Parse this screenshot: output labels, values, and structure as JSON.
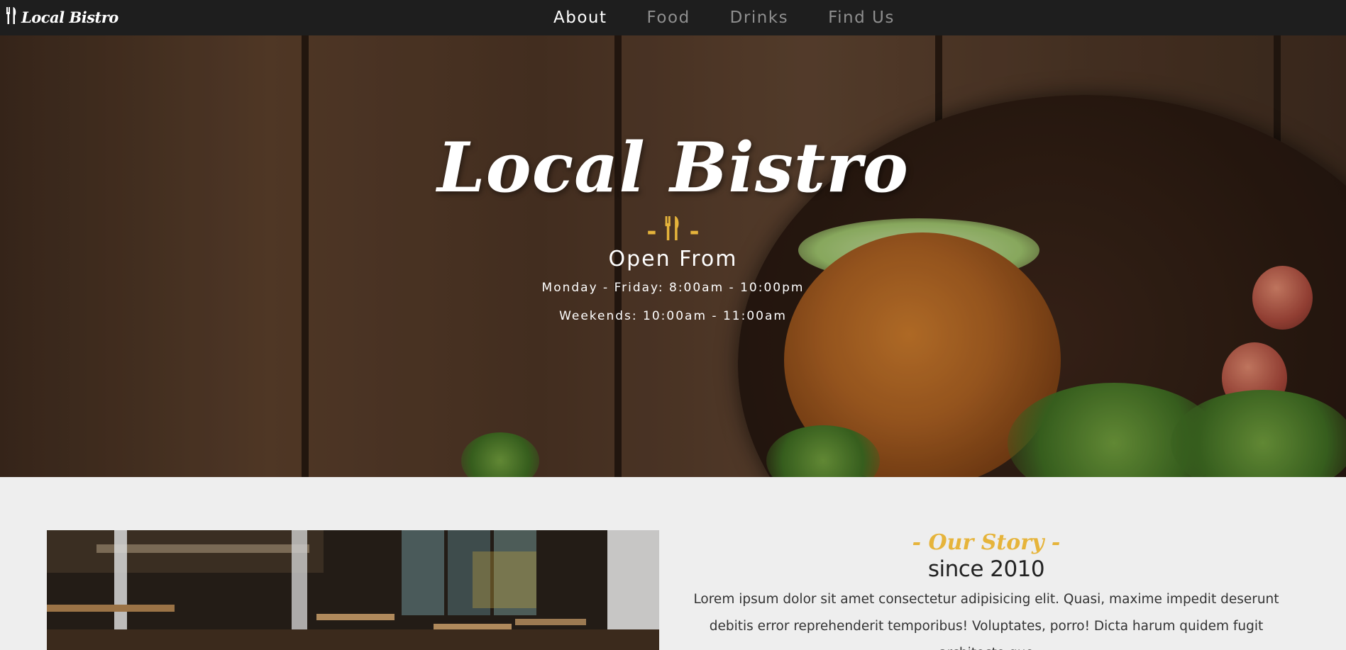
{
  "nav": {
    "brand": "Local Bistro",
    "links": [
      {
        "label": "About",
        "active": true
      },
      {
        "label": "Food",
        "active": false
      },
      {
        "label": "Drinks",
        "active": false
      },
      {
        "label": "Find Us",
        "active": false
      }
    ]
  },
  "hero": {
    "title": "Local Bistro",
    "divider_dash": "-",
    "subtitle": "Open From",
    "hours": [
      "Monday - Friday: 8:00am - 10:00pm",
      "Weekends: 10:00am - 11:00am"
    ]
  },
  "about": {
    "heading": "- Our Story -",
    "subheading": "since 2010",
    "body": "Lorem ipsum dolor sit amet consectetur adipisicing elit. Quasi, maxime impedit deserunt debitis error reprehenderit temporibus! Voluptates, porro! Dicta harum quidem fugit architecto quo"
  },
  "colors": {
    "accent": "#e6b43b",
    "nav_bg": "#1e1e1e",
    "nav_active": "#ffffff",
    "nav_inactive": "#8f8f8f",
    "page_bg": "#eeeeee"
  },
  "icons": {
    "brand_icon": "fork-knife-icon",
    "divider_icon": "fork-knife-icon"
  }
}
